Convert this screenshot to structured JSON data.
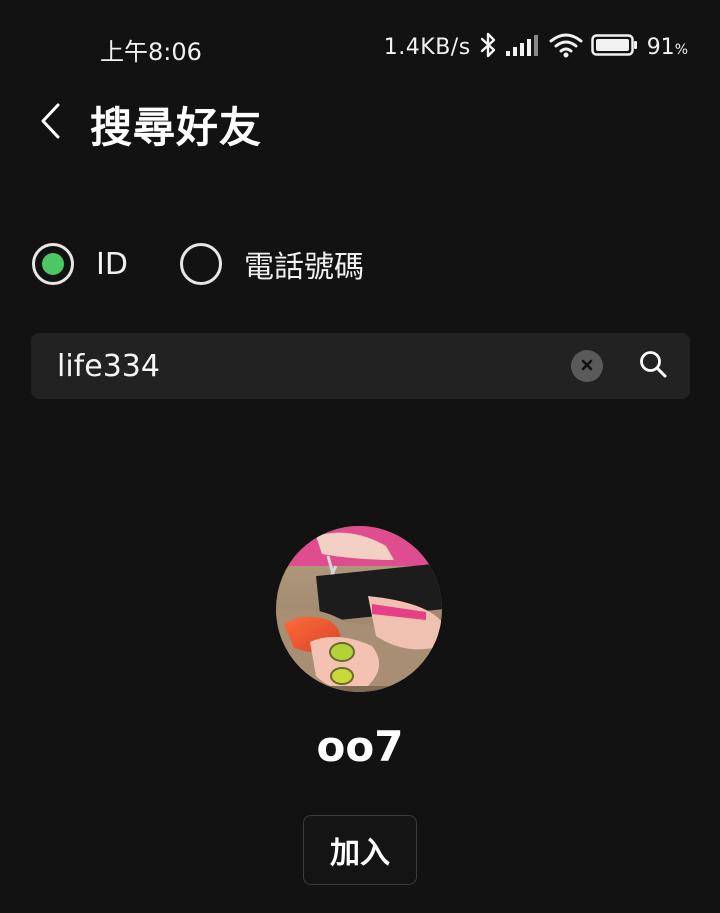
{
  "status_bar": {
    "time": "上午8:06",
    "net_speed": "1.4KB/s",
    "battery_level": "91",
    "battery_unit": "%",
    "icons": [
      "bluetooth-icon",
      "signal-icon",
      "wifi-icon",
      "battery-icon"
    ]
  },
  "header": {
    "title": "搜尋好友",
    "back_icon": "chevron-left-icon"
  },
  "search_mode": {
    "options": [
      {
        "label": "ID",
        "selected": true
      },
      {
        "label": "電話號碼",
        "selected": false
      }
    ],
    "selected_color": "#4cc764"
  },
  "search": {
    "value": "life334",
    "clear_icon": "clear-icon",
    "search_icon": "search-icon"
  },
  "result": {
    "name": "oo7",
    "add_label": "加入"
  },
  "colors": {
    "background": "#121212",
    "search_field": "#222222",
    "accent": "#4cc764"
  }
}
